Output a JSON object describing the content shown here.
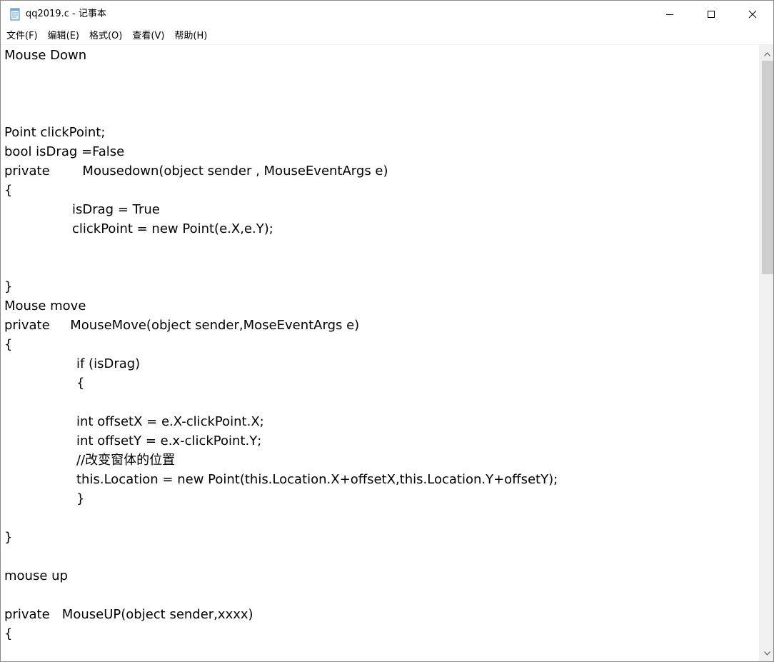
{
  "window": {
    "title": "qq2019.c - 记事本",
    "icon": "notepad-icon",
    "controls": {
      "minimize": "minimize-icon",
      "maximize": "maximize-icon",
      "close": "close-icon"
    }
  },
  "menu": {
    "items": [
      "文件(F)",
      "编辑(E)",
      "格式(O)",
      "查看(V)",
      "帮助(H)"
    ]
  },
  "document": {
    "lines": [
      {
        "indent": 0,
        "text": "Mouse Down"
      },
      {
        "indent": 0,
        "text": ""
      },
      {
        "indent": 0,
        "text": ""
      },
      {
        "indent": 0,
        "text": ""
      },
      {
        "indent": 0,
        "text": "Point clickPoint;"
      },
      {
        "indent": 0,
        "text": "bool isDrag =False"
      },
      {
        "indent": 0,
        "text": "private        Mousedown(object sender , MouseEventArgs e)"
      },
      {
        "indent": 0,
        "text": "{"
      },
      {
        "indent": 1,
        "text": "isDrag = True"
      },
      {
        "indent": 1,
        "text": "clickPoint = new Point(e.X,e.Y);"
      },
      {
        "indent": 0,
        "text": ""
      },
      {
        "indent": 0,
        "text": ""
      },
      {
        "indent": 0,
        "text": "}"
      },
      {
        "indent": 0,
        "text": "Mouse move"
      },
      {
        "indent": 0,
        "text": "private     MouseMove(object sender,MoseEventArgs e)"
      },
      {
        "indent": 0,
        "text": "{"
      },
      {
        "indent": 2,
        "text": "if (isDrag)"
      },
      {
        "indent": 2,
        "text": "{"
      },
      {
        "indent": 0,
        "text": ""
      },
      {
        "indent": 2,
        "text": "int offsetX = e.X-clickPoint.X;"
      },
      {
        "indent": 2,
        "text": "int offsetY = e.x-clickPoint.Y;"
      },
      {
        "indent": 2,
        "text": "//改变窗体的位置"
      },
      {
        "indent": 2,
        "text": "this.Location = new Point(this.Location.X+offsetX,this.Location.Y+offsetY);"
      },
      {
        "indent": 2,
        "text": "}"
      },
      {
        "indent": 0,
        "text": ""
      },
      {
        "indent": 0,
        "text": "}"
      },
      {
        "indent": 0,
        "text": ""
      },
      {
        "indent": 0,
        "text": "mouse up"
      },
      {
        "indent": 0,
        "text": ""
      },
      {
        "indent": 0,
        "text": "private   MouseUP(object sender,xxxx)"
      },
      {
        "indent": 0,
        "text": "{"
      }
    ]
  },
  "scrollbar": {
    "up": "scroll-up-arrow-icon",
    "down": "scroll-down-arrow-icon",
    "position": 0
  }
}
